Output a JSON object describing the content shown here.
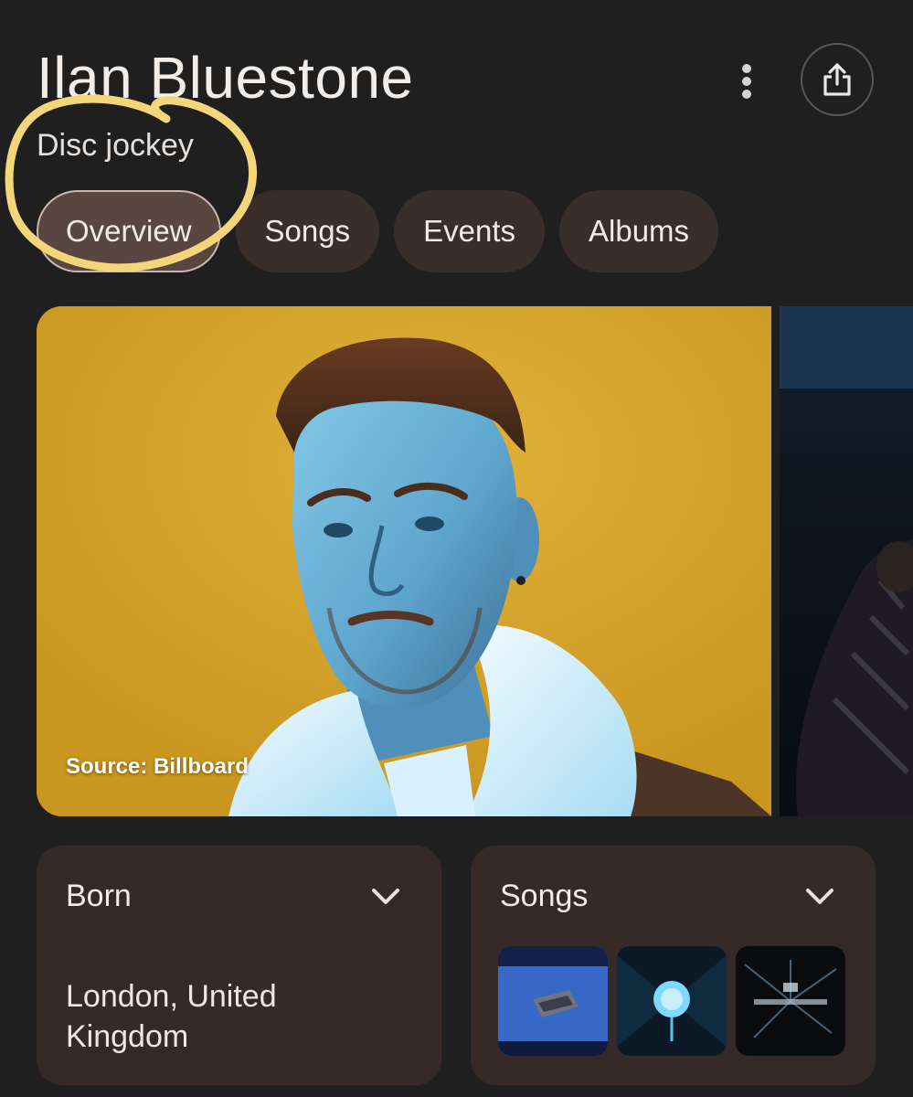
{
  "header": {
    "title": "Ilan Bluestone",
    "subtitle": "Disc jockey",
    "more_icon": "more-vert-icon",
    "share_icon": "share-icon"
  },
  "tabs": [
    {
      "label": "Overview",
      "active": true
    },
    {
      "label": "Songs",
      "active": false
    },
    {
      "label": "Events",
      "active": false
    },
    {
      "label": "Albums",
      "active": false
    }
  ],
  "hero": {
    "source": "Source: Billboard"
  },
  "born_card": {
    "title": "Born",
    "value": "London, United Kingdom"
  },
  "songs_card": {
    "title": "Songs",
    "thumbs": [
      {
        "icon": "album-art-blue-icon"
      },
      {
        "icon": "album-art-rose-icon"
      },
      {
        "icon": "album-art-dark-icon"
      }
    ]
  },
  "colors": {
    "background": "#1f1f1f",
    "chip": "#3a2e2b",
    "chip_active": "#5a4640",
    "card": "#352a27",
    "highlight": "#f3d57a"
  }
}
